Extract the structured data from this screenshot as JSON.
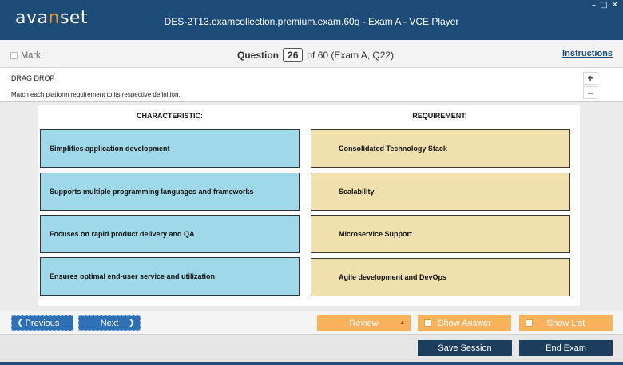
{
  "app": {
    "logo_prefix": "ava",
    "logo_accent": "n",
    "logo_suffix": "set",
    "window_title": "DES-2T13.examcollection.premium.exam.60q - Exam A - VCE Player",
    "controls": [
      "–",
      "□",
      "✕"
    ]
  },
  "question_bar": {
    "mark_label": "Mark",
    "question_label": "Question",
    "question_number": "26",
    "question_suffix": "of 60 (Exam A, Q22)",
    "instructions_label": "Instructions"
  },
  "question": {
    "type": "DRAG DROP",
    "text": "Match each platform requirement to its respective definition.",
    "zoom_in": "+",
    "zoom_out": "–"
  },
  "drag_drop": {
    "left_header": "CHARACTERISTIC:",
    "right_header": "REQUIREMENT:",
    "characteristics": [
      "Simplifies application development",
      "Supports multiple programming languages and frameworks",
      "Focuses on rapid product delivery and QA",
      "Ensures optimal end-user service and utilization"
    ],
    "requirements": [
      "Consolidated Technology Stack",
      "Scalability",
      "Microservice Support",
      "Agile development and DevOps"
    ]
  },
  "nav": {
    "previous": "Previous",
    "next": "Next",
    "review": "Review",
    "show_answer": "Show Answer",
    "show_list": "Show List"
  },
  "bottom": {
    "save_session": "Save Session",
    "end_exam": "End Exam"
  },
  "colors": {
    "titlebar": "#1d4c78",
    "logo_accent": "#f39a2b",
    "characteristic_card": "#9fd8e8",
    "requirement_card": "#efe0ad",
    "nav_blue": "#2e70b8",
    "nav_orange": "#f8b25a",
    "dark_button": "#1d3d5c"
  }
}
